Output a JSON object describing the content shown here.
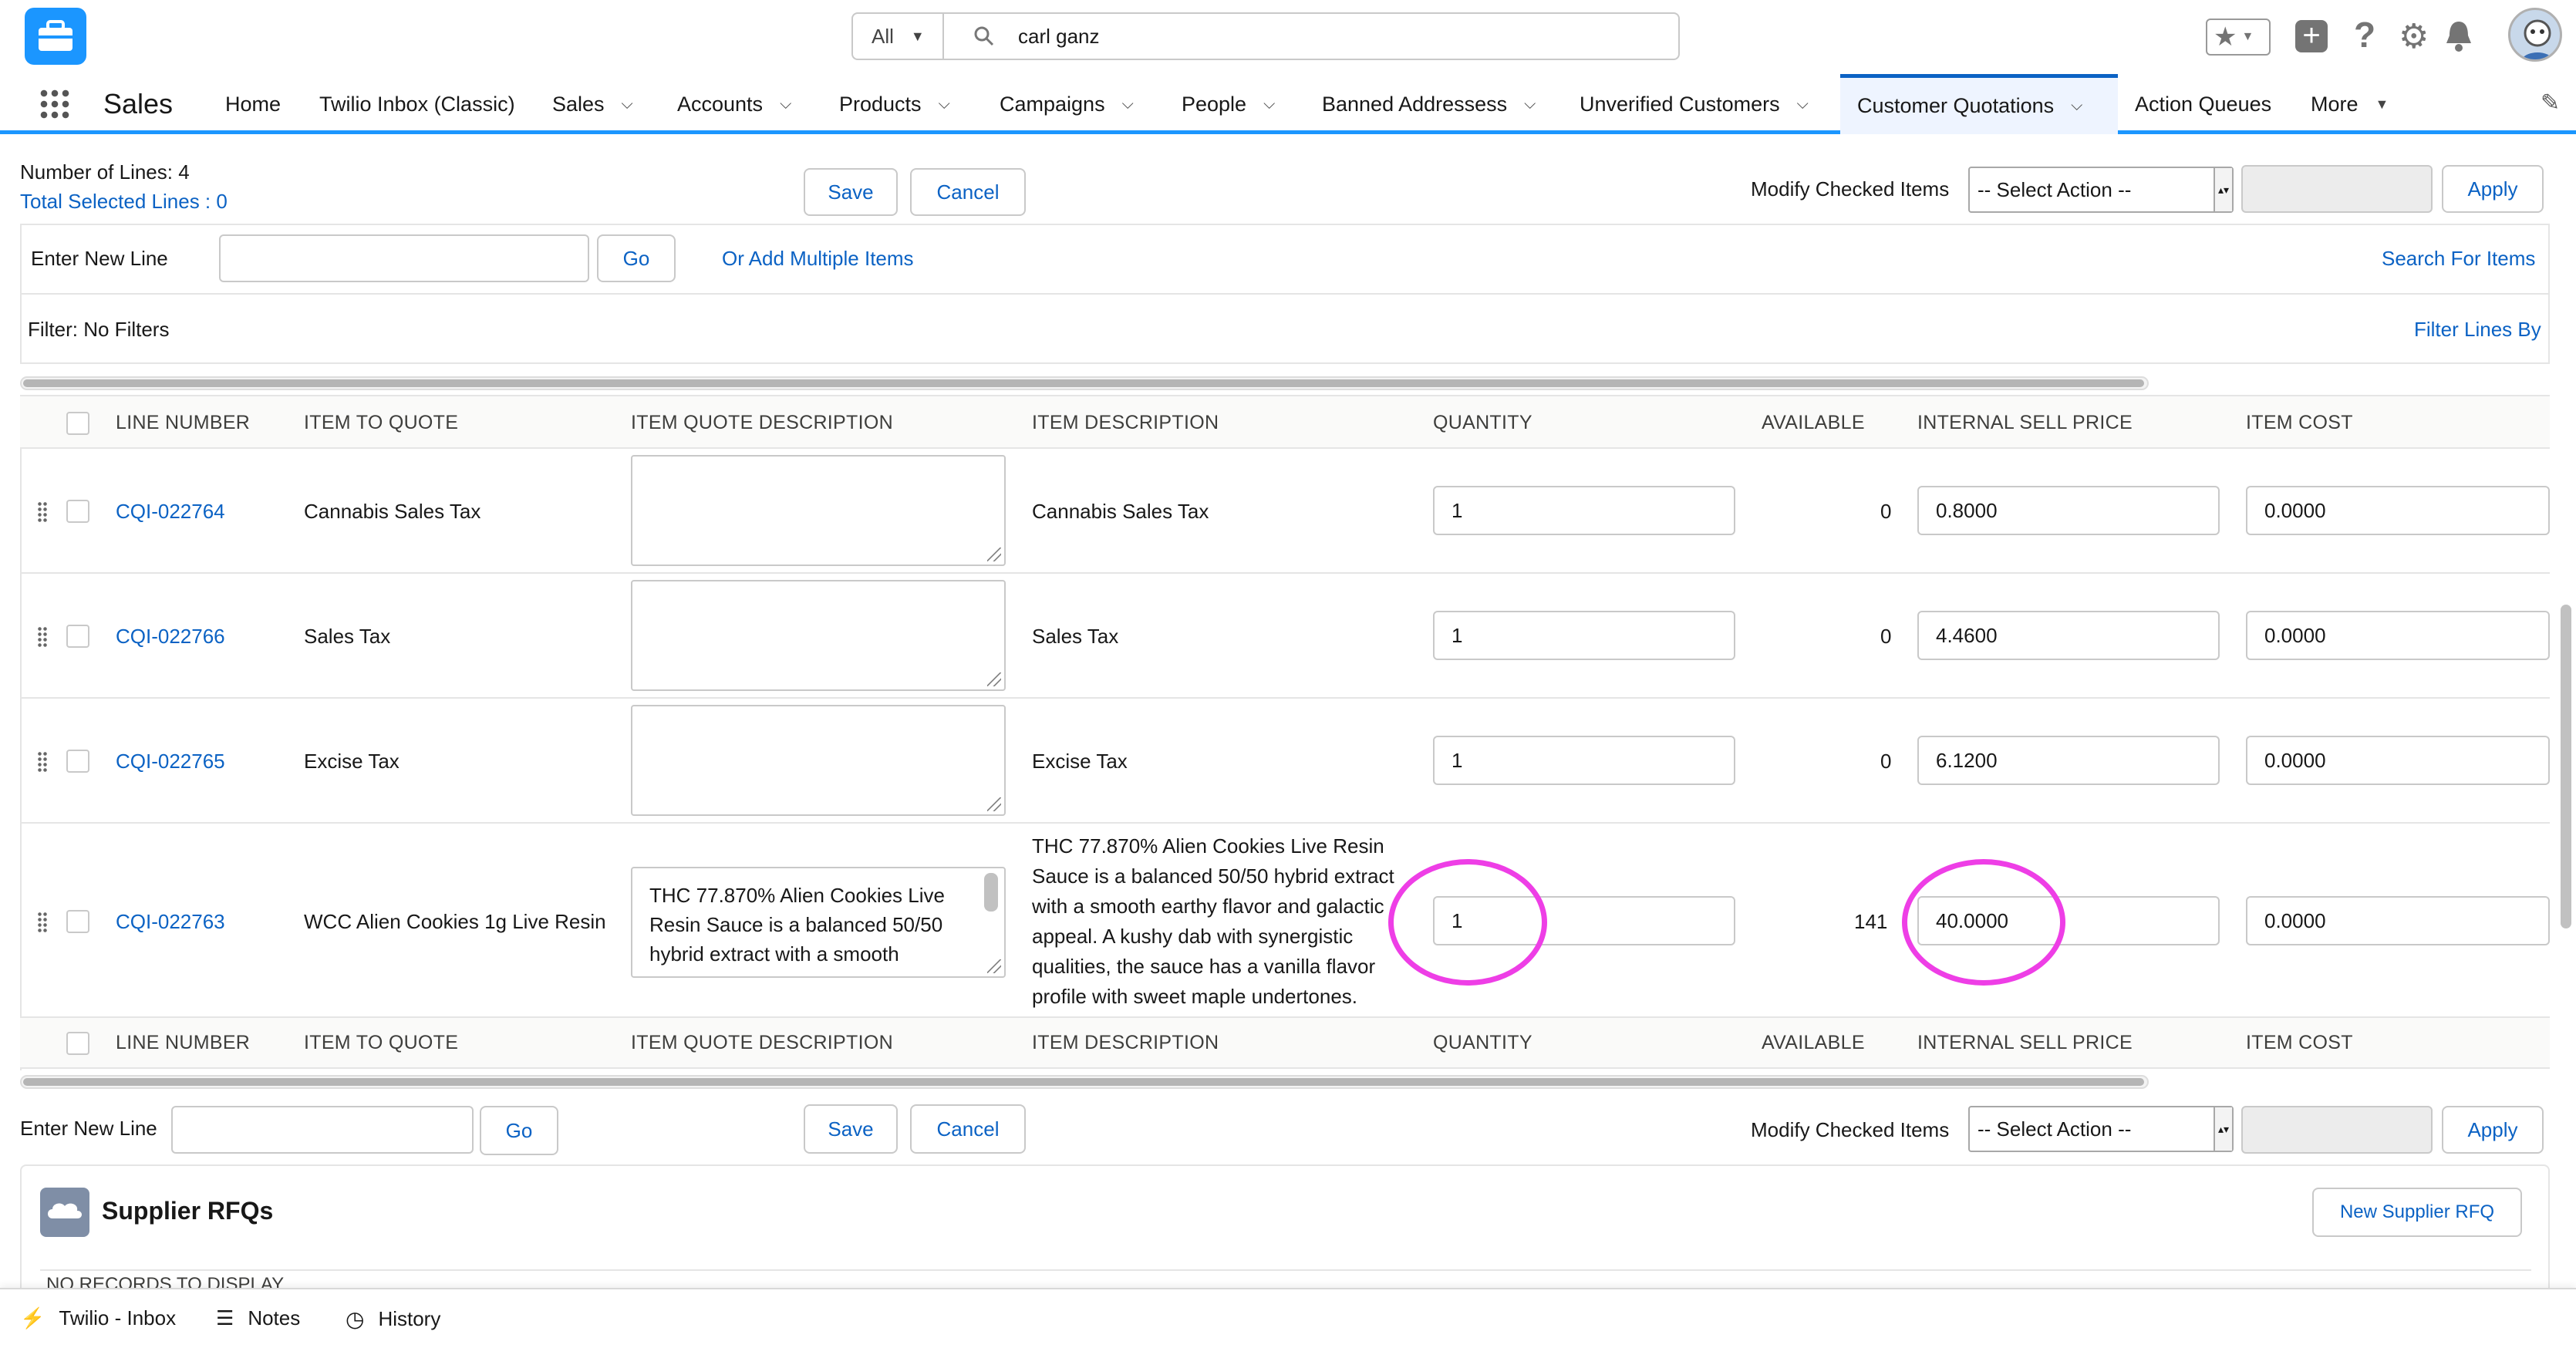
{
  "header": {
    "search_scope": "All",
    "search_value": "carl ganz"
  },
  "nav": {
    "app_name": "Sales",
    "items": [
      "Home",
      "Twilio Inbox (Classic)",
      "Sales",
      "Accounts",
      "Products",
      "Campaigns",
      "People",
      "Banned Addressess",
      "Unverified Customers",
      "Customer Quotations",
      "Action Queues",
      "More"
    ]
  },
  "toolbar": {
    "number_of_lines": "Number of Lines: 4",
    "total_selected": "Total Selected Lines : 0",
    "save_label": "Save",
    "cancel_label": "Cancel",
    "modify_label": "Modify Checked Items",
    "select_action": "-- Select Action --",
    "apply_label": "Apply",
    "enter_new_line": "Enter New Line",
    "go_label": "Go",
    "add_multiple": "Or Add Multiple Items",
    "search_items": "Search For Items",
    "filter_text": "Filter: No Filters",
    "filter_lines_by": "Filter Lines By"
  },
  "table": {
    "columns": [
      "LINE NUMBER",
      "ITEM TO QUOTE",
      "ITEM QUOTE DESCRIPTION",
      "ITEM DESCRIPTION",
      "QUANTITY",
      "AVAILABLE",
      "INTERNAL SELL PRICE",
      "ITEM COST"
    ],
    "rows": [
      {
        "line": "CQI-022764",
        "item": "Cannabis Sales Tax",
        "quote_desc": "",
        "desc": "Cannabis Sales Tax",
        "qty": "1",
        "available": "0",
        "sell_price": "0.8000",
        "cost": "0.0000"
      },
      {
        "line": "CQI-022766",
        "item": "Sales Tax",
        "quote_desc": "",
        "desc": "Sales Tax",
        "qty": "1",
        "available": "0",
        "sell_price": "4.4600",
        "cost": "0.0000"
      },
      {
        "line": "CQI-022765",
        "item": "Excise Tax",
        "quote_desc": "",
        "desc": "Excise Tax",
        "qty": "1",
        "available": "0",
        "sell_price": "6.1200",
        "cost": "0.0000"
      },
      {
        "line": "CQI-022763",
        "item": "WCC Alien Cookies 1g Live Resin",
        "quote_desc": "THC 77.870% Alien Cookies Live Resin Sauce is a balanced 50/50 hybrid extract with a smooth",
        "desc": "THC 77.870% Alien Cookies Live Resin Sauce is a balanced 50/50 hybrid extract with a smooth earthy flavor and galactic appeal. A kushy dab with synergistic qualities, the sauce has a vanilla flavor profile with sweet maple undertones.",
        "qty": "1",
        "available": "141",
        "sell_price": "40.0000",
        "cost": "0.0000"
      }
    ]
  },
  "bottom": {
    "enter_new_line": "Enter New Line",
    "go_label": "Go",
    "save_label": "Save",
    "cancel_label": "Cancel",
    "modify_label": "Modify Checked Items",
    "select_action": "-- Select Action --",
    "apply_label": "Apply"
  },
  "rfq": {
    "title": "Supplier RFQs",
    "new_button": "New Supplier RFQ",
    "empty": "NO RECORDS TO DISPLAY"
  },
  "utility_bar": {
    "items": [
      "Twilio - Inbox",
      "Notes",
      "History"
    ]
  },
  "colors": {
    "brand": "#1b96ff",
    "link": "#0b62c4",
    "highlight": "#ee3ee6"
  }
}
